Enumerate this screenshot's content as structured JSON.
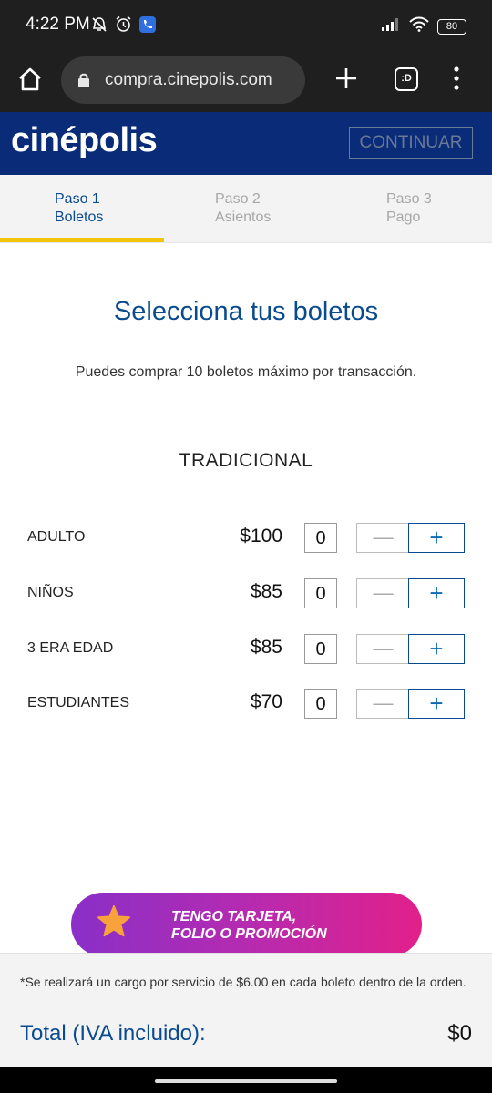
{
  "status_bar": {
    "time": "4:22 PM",
    "left_icons": [
      "mute-icon",
      "alarm-icon",
      "phone-icon"
    ],
    "right_icons": [
      "signal-icon",
      "wifi-icon",
      "battery-icon"
    ],
    "battery": "80"
  },
  "browser": {
    "url": "compra.cinepolis.com",
    "tabs_label": ":D",
    "icons": [
      "home-icon",
      "lock-icon",
      "plus-icon",
      "tabs-icon",
      "more-vert-icon"
    ]
  },
  "header": {
    "logo": "cinépolis",
    "continue_label": "CONTINUAR"
  },
  "steps": [
    {
      "step": "Paso 1",
      "label": "Boletos",
      "active": true
    },
    {
      "step": "Paso 2",
      "label": "Asientos",
      "active": false
    },
    {
      "step": "Paso 3",
      "label": "Pago",
      "active": false
    }
  ],
  "main": {
    "title": "Selecciona tus boletos",
    "subtitle": "Puedes comprar 10 boletos máximo por transacción.",
    "section": "TRADICIONAL",
    "tickets": [
      {
        "name": "ADULTO",
        "price": "$100",
        "qty": "0"
      },
      {
        "name": "NIÑOS",
        "price": "$85",
        "qty": "0"
      },
      {
        "name": "3 ERA EDAD",
        "price": "$85",
        "qty": "0"
      },
      {
        "name": "ESTUDIANTES",
        "price": "$70",
        "qty": "0"
      }
    ],
    "minus_symbol": "—",
    "plus_symbol": "+"
  },
  "promo": {
    "line1": "TENGO TARJETA,",
    "line2": "FOLIO O PROMOCIÓN"
  },
  "footer": {
    "note": "*Se realizará un cargo por servicio de $6.00 en cada boleto dentro de la orden.",
    "total_label": "Total (IVA incluido):",
    "total_value": "$0"
  },
  "colors": {
    "brand_blue": "#0a2b78",
    "accent_blue": "#0a4a8f",
    "step_highlight": "#f4c60b",
    "promo_start": "#8a2fc8",
    "promo_end": "#e2208a"
  }
}
